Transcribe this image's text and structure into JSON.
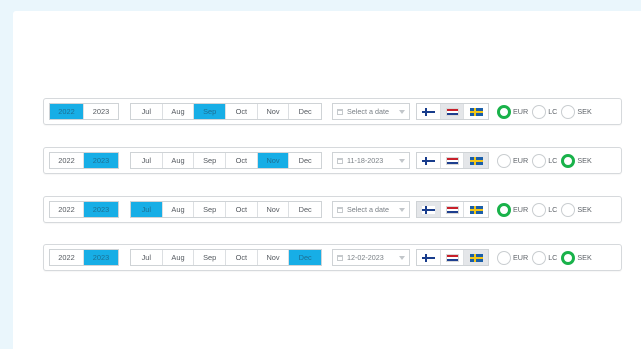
{
  "colors": {
    "accent": "#17aee6",
    "radio_on": "#19b24a",
    "background": "#eaf6fc"
  },
  "years": [
    "2022",
    "2023"
  ],
  "months": [
    "Jul",
    "Aug",
    "Sep",
    "Oct",
    "Nov",
    "Dec"
  ],
  "flags": [
    {
      "name": "finland-flag-icon",
      "css": "flag-fi"
    },
    {
      "name": "netherlands-flag-icon",
      "css": "flag-nl"
    },
    {
      "name": "sweden-flag-icon",
      "css": "flag-se"
    }
  ],
  "currencies": [
    "EUR",
    "LC",
    "SEK"
  ],
  "rows": [
    {
      "year": "2022",
      "month": "Sep",
      "date": "Select a date",
      "flag": 1,
      "currency": "EUR"
    },
    {
      "year": "2023",
      "month": "Nov",
      "date": "11-18-2023",
      "flag": 2,
      "currency": "SEK"
    },
    {
      "year": "2023",
      "month": "Jul",
      "date": "Select a date",
      "flag": 0,
      "currency": "EUR"
    },
    {
      "year": "2023",
      "month": "Dec",
      "date": "12-02-2023",
      "flag": 2,
      "currency": "SEK"
    }
  ]
}
